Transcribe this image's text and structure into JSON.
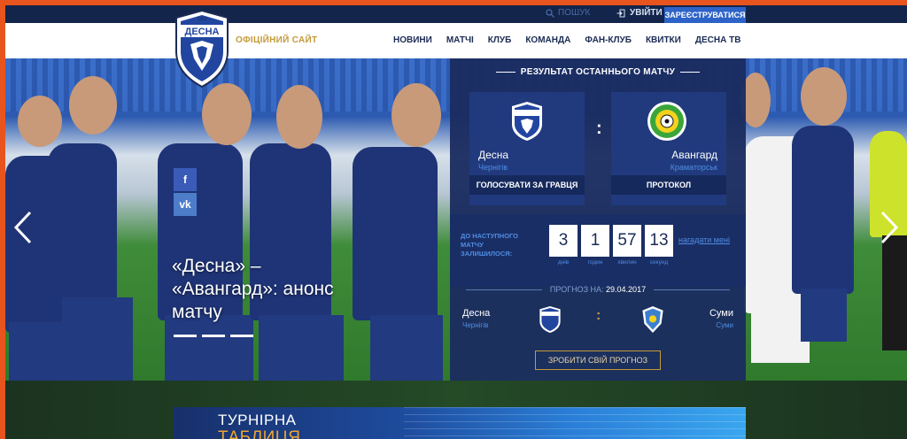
{
  "colors": {
    "accent": "#2d63c8",
    "brand_navy": "#1b2c55",
    "gold": "#c49a3a",
    "link_blue": "#4f8de0",
    "frame_orange": "#e8541d"
  },
  "topbar": {
    "search_label": "ПОШУК",
    "search_icon": "search-icon",
    "login_label": "УВІЙТИ",
    "login_icon": "login-icon",
    "register_label": "ЗАРЕЄСТРУВАТИСЯ"
  },
  "header": {
    "logo_year": "1960",
    "logo_text": "ДЕСНА",
    "site_label": "ОФІЦІЙНИЙ САЙТ",
    "menu": [
      "НОВИНИ",
      "МАТЧІ",
      "КЛУБ",
      "КОМАНДА",
      "ФАН-КЛУБ",
      "КВИТКИ",
      "ДЕСНА ТВ"
    ]
  },
  "hero": {
    "headline": "«Десна» – «Авангард»: анонс матчу",
    "social": [
      "f",
      "vk"
    ],
    "prev_icon": "chevron-left-icon",
    "next_icon": "chevron-right-icon"
  },
  "last_match": {
    "title": "РЕЗУЛЬТАТ ОСТАННЬОГО МАТЧУ",
    "home": {
      "name": "Десна",
      "city": "Чернігів",
      "button": "ГОЛОСУВАТИ ЗА ГРАВЦЯ"
    },
    "away": {
      "name": "Авангард",
      "city": "Краматорськ",
      "button": "ПРОТОКОЛ"
    },
    "separator": ":"
  },
  "countdown": {
    "label": "ДО НАСТУПНОГО МАТЧУ ЗАЛИШИЛОСЯ:",
    "days": "3",
    "hours": "1",
    "minutes": "57",
    "seconds": "13",
    "days_label": "днів",
    "hours_label": "годин",
    "minutes_label": "хвилин",
    "seconds_label": "секунд",
    "remind": "нагадати мені"
  },
  "forecast": {
    "title": "ПРОГНОЗ НА:",
    "date": "29.04.2017",
    "home": {
      "name": "Десна",
      "city": "Чернігів"
    },
    "away": {
      "name": "Суми",
      "city": "Суми"
    },
    "separator": ":",
    "button": "ЗРОБИТИ СВІЙ ПРОГНОЗ"
  },
  "table_banner": {
    "line1": "ТУРНІРНА",
    "line2": "ТАБЛИЦЯ"
  }
}
